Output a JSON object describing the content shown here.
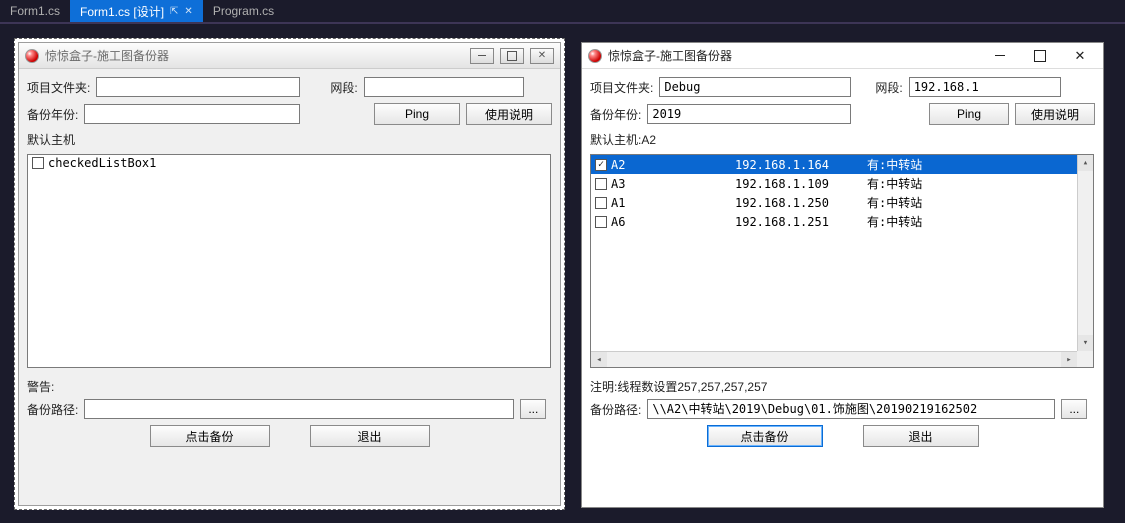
{
  "tabs": [
    {
      "label": "Form1.cs",
      "active": false
    },
    {
      "label": "Form1.cs [设计]",
      "active": true,
      "pinnable": true,
      "closable": true
    },
    {
      "label": "Program.cs",
      "active": false
    }
  ],
  "design_window": {
    "title": "惊惊盒子-施工图备份器",
    "labels": {
      "project_folder": "项目文件夹:",
      "net_segment": "网段:",
      "backup_year": "备份年份:",
      "ping": "Ping",
      "usage": "使用说明",
      "default_host": "默认主机",
      "warning": "警告:",
      "backup_path": "备份路径:",
      "browse": "...",
      "backup_btn": "点击备份",
      "exit_btn": "退出"
    },
    "fields": {
      "project_folder": "",
      "net_segment": "",
      "backup_year": "",
      "backup_path": ""
    },
    "checked_list_placeholder": "checkedListBox1"
  },
  "runtime_window": {
    "title": "惊惊盒子-施工图备份器",
    "labels": {
      "project_folder": "项目文件夹:",
      "net_segment": "网段:",
      "backup_year": "备份年份:",
      "ping": "Ping",
      "usage": "使用说明",
      "default_host_prefix": "默认主机:",
      "note": "注明:线程数设置257,257,257,257",
      "backup_path": "备份路径:",
      "browse": "...",
      "backup_btn": "点击备份",
      "exit_btn": "退出"
    },
    "fields": {
      "project_folder": "Debug",
      "net_segment": "192.168.1",
      "backup_year": "2019",
      "backup_path": "\\\\A2\\中转站\\2019\\Debug\\01.饰施图\\20190219162502"
    },
    "default_host_value": "A2",
    "hosts": [
      {
        "checked": true,
        "name": "A2",
        "ip": "192.168.1.164",
        "flag": "有:中转站",
        "selected": true
      },
      {
        "checked": false,
        "name": "A3",
        "ip": "192.168.1.109",
        "flag": "有:中转站",
        "selected": false
      },
      {
        "checked": false,
        "name": "A1",
        "ip": "192.168.1.250",
        "flag": "有:中转站",
        "selected": false
      },
      {
        "checked": false,
        "name": "A6",
        "ip": "192.168.1.251",
        "flag": "有:中转站",
        "selected": false
      }
    ]
  }
}
